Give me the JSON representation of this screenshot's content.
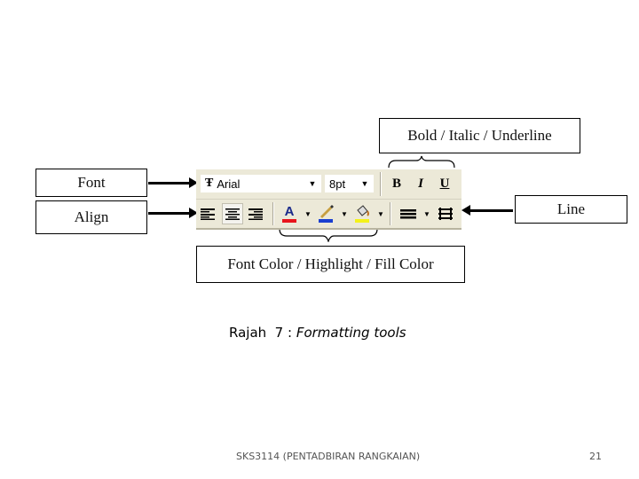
{
  "labels": {
    "bold_italic_underline": "Bold / Italic / Underline",
    "font": "Font",
    "align": "Align",
    "line": "Line",
    "font_color_highlight_fill": "Font Color / Highlight / Fill Color"
  },
  "toolbar": {
    "font_name": "Arial",
    "font_size": "8pt",
    "bold": "B",
    "italic": "I",
    "underline": "U",
    "font_color_glyph": "A",
    "colors": {
      "font_color": "#e8141c",
      "highlight": "#1a3fd0",
      "fill_color": "#f4f21a",
      "toolbar_bg": "#ece9d8"
    }
  },
  "caption": {
    "prefix": "Rajah  7 : ",
    "italic_text": "Formatting tools"
  },
  "footer": {
    "course": "SKS3114 (PENTADBIRAN RANGKAIAN)",
    "page_number": "21"
  }
}
